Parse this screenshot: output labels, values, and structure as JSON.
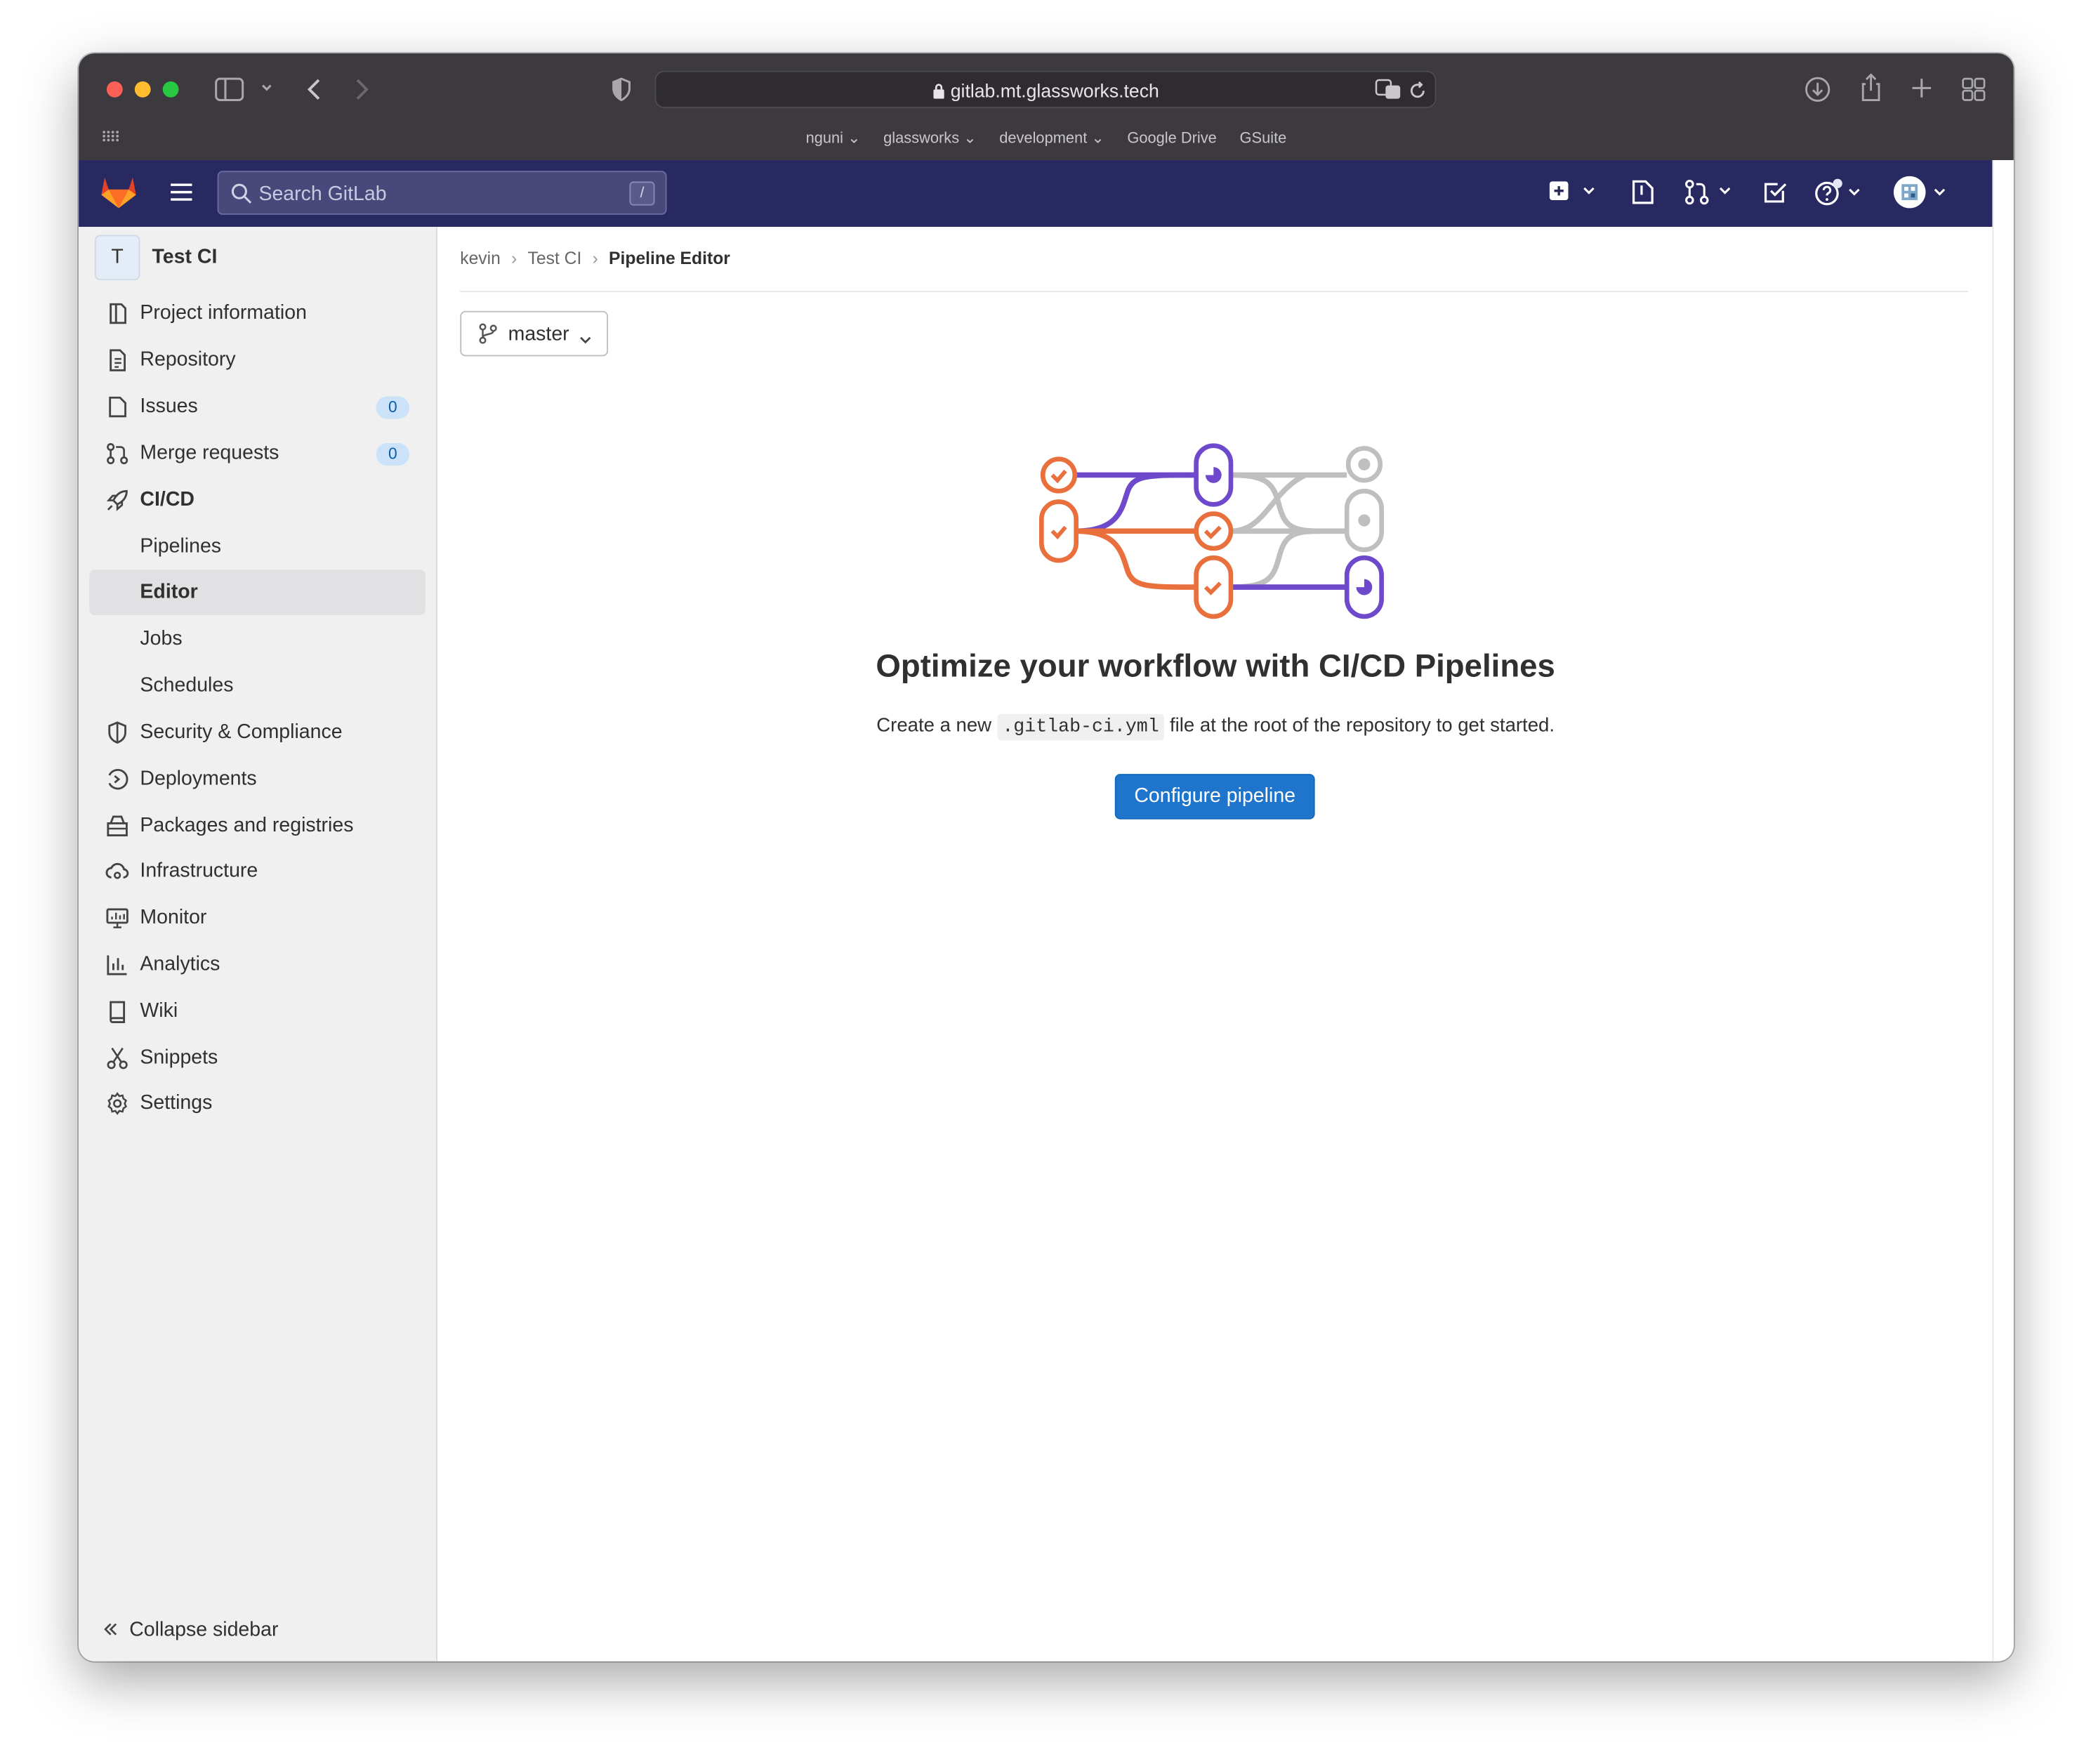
{
  "browser": {
    "url": "gitlab.mt.glassworks.tech",
    "bookmarks": [
      "nguni",
      "glassworks",
      "development",
      "Google Drive",
      "GSuite"
    ]
  },
  "topnav": {
    "search_placeholder": "Search GitLab",
    "search_shortcut": "/"
  },
  "sidebar": {
    "project_initial": "T",
    "project_name": "Test CI",
    "items": [
      {
        "label": "Project information",
        "icon": "info-icon"
      },
      {
        "label": "Repository",
        "icon": "document-icon"
      },
      {
        "label": "Issues",
        "icon": "issues-icon",
        "badge": "0"
      },
      {
        "label": "Merge requests",
        "icon": "merge-request-icon",
        "badge": "0"
      },
      {
        "label": "CI/CD",
        "icon": "rocket-icon"
      },
      {
        "label": "Pipelines"
      },
      {
        "label": "Editor",
        "active": true
      },
      {
        "label": "Jobs"
      },
      {
        "label": "Schedules"
      },
      {
        "label": "Security & Compliance",
        "icon": "shield-icon"
      },
      {
        "label": "Deployments",
        "icon": "deployments-icon"
      },
      {
        "label": "Packages and registries",
        "icon": "package-icon"
      },
      {
        "label": "Infrastructure",
        "icon": "cloud-gear-icon"
      },
      {
        "label": "Monitor",
        "icon": "monitor-icon"
      },
      {
        "label": "Analytics",
        "icon": "chart-icon"
      },
      {
        "label": "Wiki",
        "icon": "book-icon"
      },
      {
        "label": "Snippets",
        "icon": "scissors-icon"
      },
      {
        "label": "Settings",
        "icon": "gear-icon"
      }
    ],
    "collapse_label": "Collapse sidebar"
  },
  "breadcrumb": {
    "items": [
      "kevin",
      "Test CI",
      "Pipeline Editor"
    ]
  },
  "branch_selector": {
    "value": "master"
  },
  "empty_state": {
    "title": "Optimize your workflow with CI/CD Pipelines",
    "desc_before": "Create a new ",
    "desc_code": ".gitlab-ci.yml",
    "desc_after": " file at the root of the repository to get started.",
    "button": "Configure pipeline"
  },
  "colors": {
    "nav_bg": "#292961",
    "primary": "#1f75cb",
    "orange": "#e9703d",
    "purple": "#6e49cb",
    "gray": "#bfbfbf"
  }
}
